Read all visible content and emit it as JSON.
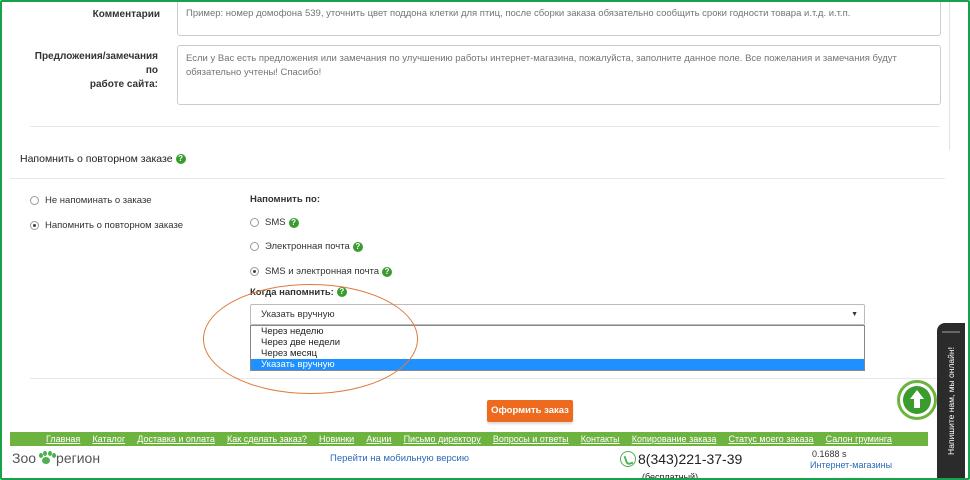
{
  "form": {
    "comment_label": "Комментарии",
    "comment_placeholder": "Пример: номер домофона 539, уточнить цвет поддона клетки для птиц, после сборки заказа обязательно сообщить сроки годности товара и.т.д. и.т.п.",
    "suggest_label_line1": "Предложения/замечания по",
    "suggest_label_line2": "работе сайта:",
    "suggest_placeholder": "Если у Вас есть предложения или замечания по улучшению работы интернет-магазина, пожалуйста, заполните данное поле. Все пожелания и замечания будут обязательно учтены! Спасибо!"
  },
  "reminder": {
    "section_title": "Напомнить о повторном заказе",
    "help_icon": "question-icon",
    "options": [
      {
        "label": "Не напоминать о заказе",
        "selected": false
      },
      {
        "label": "Напомнить о повторном заказе",
        "selected": true
      }
    ],
    "via_label": "Напомнить по:",
    "via_options": [
      {
        "label": "SMS",
        "selected": false
      },
      {
        "label": "Электронная почта",
        "selected": false
      },
      {
        "label": "SMS и электронная почта",
        "selected": true
      }
    ],
    "when_label": "Когда напомнить:",
    "select_value": "Указать вручную",
    "dropdown_options": [
      {
        "label": "Через неделю",
        "selected": false
      },
      {
        "label": "Через две недели",
        "selected": false
      },
      {
        "label": "Через месяц",
        "selected": false
      },
      {
        "label": "Указать вручную",
        "selected": true
      }
    ]
  },
  "submit_label": "Оформить заказ",
  "nav": [
    "Главная",
    "Каталог",
    "Доставка и оплата",
    "Как сделать заказ?",
    "Новинки",
    "Акции",
    "Письмо директору",
    "Вопросы и ответы",
    "Контакты",
    "Копирование заказа",
    "Статус моего заказа",
    "Салон груминга"
  ],
  "footer": {
    "logo_left": "Зоо",
    "logo_right": "регион",
    "mobile_link": "Перейти на мобильную версию",
    "phone": "8(343)221-37-39",
    "phone_sub": "(бесплатный)",
    "speed": "0.1688 s",
    "inet_link": "Интернет-магазины"
  },
  "chat_label": "Напишите нам, мы онлайн!",
  "colors": {
    "accent_green": "#6db33f",
    "orange": "#ee6a1e",
    "select_blue": "#1e90ff",
    "annotation": "#e07a3f"
  }
}
